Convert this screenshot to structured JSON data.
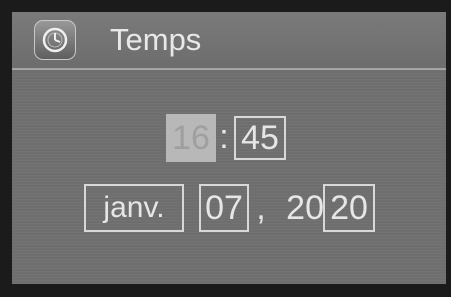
{
  "header": {
    "title": "Temps",
    "icon": "clock-icon"
  },
  "time": {
    "hour": "16",
    "separator": ":",
    "minute": "45"
  },
  "date": {
    "month": "janv.",
    "day": "07",
    "separator": ",",
    "year_prefix": "20",
    "year_suffix": "20"
  },
  "colors": {
    "screen_bg": "#6e6e6e",
    "highlight": "#b8b8b8",
    "text": "#e6e6e6"
  }
}
